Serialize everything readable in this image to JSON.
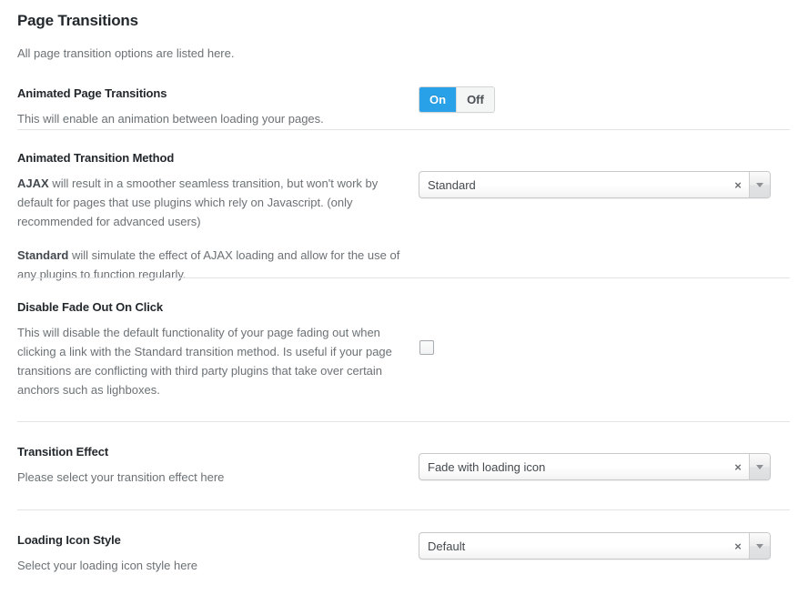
{
  "header": {
    "title": "Page Transitions",
    "subtitle": "All page transition options are listed here."
  },
  "sections": {
    "animated_page_transitions": {
      "title": "Animated Page Transitions",
      "description": "This will enable an animation between loading your pages.",
      "toggle": {
        "on_label": "On",
        "off_label": "Off",
        "selected": "On",
        "active_color": "#28a1e8"
      }
    },
    "animated_transition_method": {
      "title": "Animated Transition Method",
      "desc1_strong": "AJAX",
      "desc1_rest": " will result in a smoother seamless transition, but won't work by default for pages that use plugins which rely on Javascript. (only recommended for advanced users)",
      "desc2_strong": "Standard",
      "desc2_rest": " will simulate the effect of AJAX loading and allow for the use of any plugins to function regularly.",
      "select": {
        "value": "Standard",
        "clear_label": "×",
        "arrow_icon": "chevron-down-icon"
      }
    },
    "disable_fade_out_on_click": {
      "title": "Disable Fade Out On Click",
      "description": "This will disable the default functionality of your page fading out when clicking a link with the Standard transition method. Is useful if your page transitions are conflicting with third party plugins that take over certain anchors such as lighboxes.",
      "checkbox": {
        "checked": false
      }
    },
    "transition_effect": {
      "title": "Transition Effect",
      "description": "Please select your transition effect here",
      "select": {
        "value": "Fade with loading icon",
        "clear_label": "×",
        "arrow_icon": "chevron-down-icon"
      }
    },
    "loading_icon_style": {
      "title": "Loading Icon Style",
      "description": "Select your loading icon style here",
      "select": {
        "value": "Default",
        "clear_label": "×",
        "arrow_icon": "chevron-down-icon"
      }
    }
  }
}
